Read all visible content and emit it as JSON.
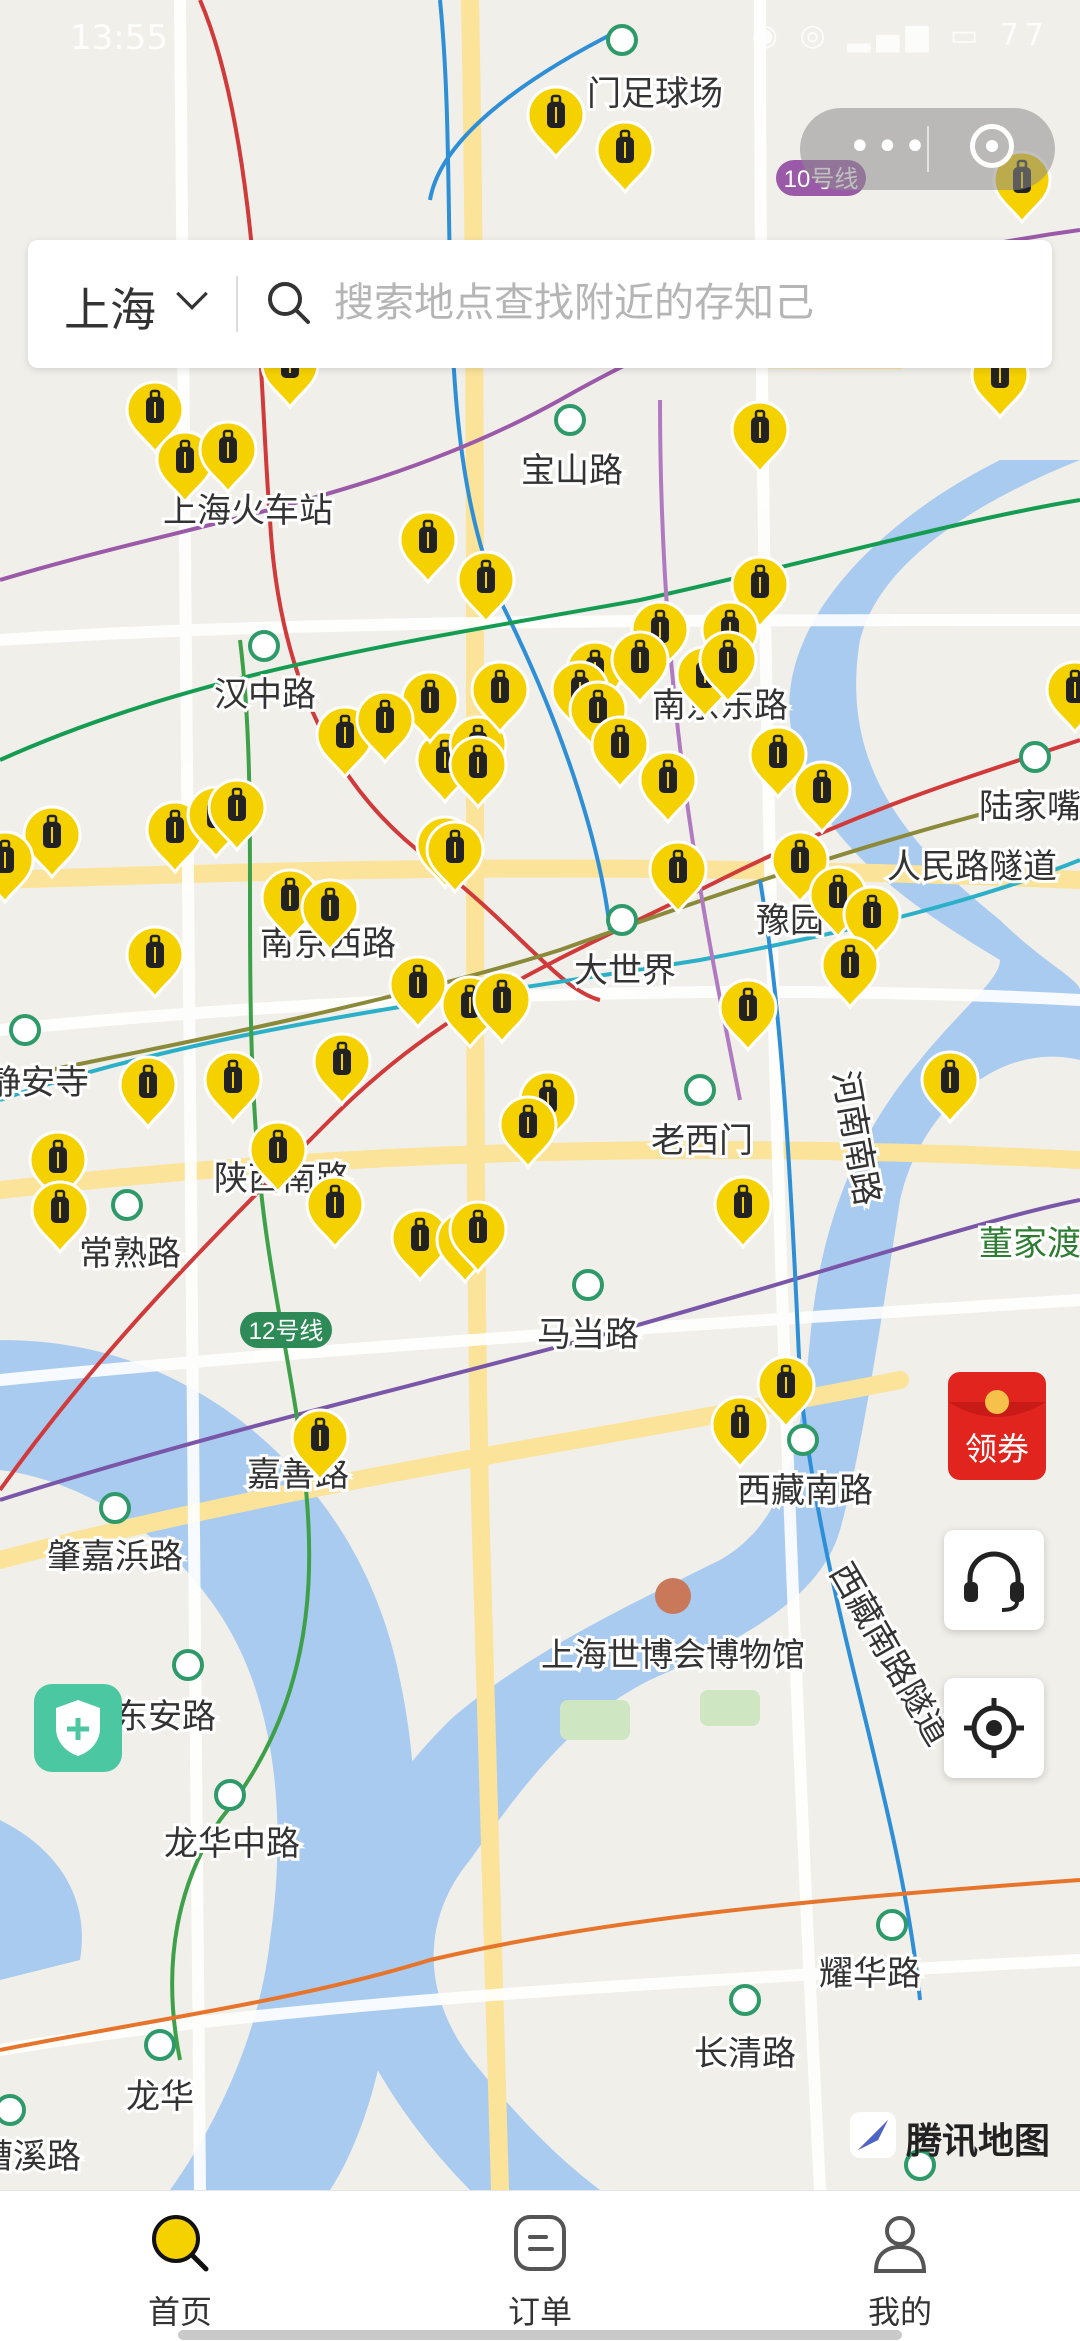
{
  "status_bar": {
    "time": "13:55",
    "battery": "77"
  },
  "search": {
    "city": "上海",
    "placeholder": "搜索地点查找附近的存知己"
  },
  "map": {
    "place_labels": [
      {
        "text": "门足球场"
      },
      {
        "text": "宝山路"
      },
      {
        "text": "上海火车站"
      },
      {
        "text": "汉中路"
      },
      {
        "text": "南京西路"
      },
      {
        "text": "大世界"
      },
      {
        "text": "豫园"
      },
      {
        "text": "陆家嘴"
      },
      {
        "text": "人民路隧道"
      },
      {
        "text": "静安寺"
      },
      {
        "text": "老西门"
      },
      {
        "text": "河南南路"
      },
      {
        "text": "陕西南路"
      },
      {
        "text": "常熟路"
      },
      {
        "text": "董家渡"
      },
      {
        "text": "马当路"
      },
      {
        "text": "嘉善路"
      },
      {
        "text": "西藏南路"
      },
      {
        "text": "肇嘉浜路"
      },
      {
        "text": "东安路"
      },
      {
        "text": "上海世博会博物馆"
      },
      {
        "text": "西藏南路隧道"
      },
      {
        "text": "龙华中路"
      },
      {
        "text": "耀华路"
      },
      {
        "text": "长清路"
      },
      {
        "text": "龙华"
      },
      {
        "text": "漕溪路"
      },
      {
        "text": "南京东路"
      }
    ],
    "line_badges": [
      {
        "text": "10号线"
      },
      {
        "text": "12号线"
      }
    ],
    "marker_count": 68,
    "marker_color": "#f5d100"
  },
  "coupon": {
    "label": "领券"
  },
  "brand": {
    "label": "腾讯地图"
  },
  "tabs": [
    {
      "label": "首页"
    },
    {
      "label": "订单"
    },
    {
      "label": "我的"
    }
  ],
  "colors": {
    "accent": "#f5d100",
    "water": "#aacbf0",
    "shield": "#4bc7a2",
    "coupon_red": "#e2241f"
  },
  "icons": {
    "customer_service": "headset-icon",
    "locate": "locate-icon",
    "shield": "shield-icon",
    "search": "search-icon",
    "home": "search-icon",
    "orders": "order-icon",
    "profile": "user-icon",
    "marker": "luggage-icon"
  }
}
